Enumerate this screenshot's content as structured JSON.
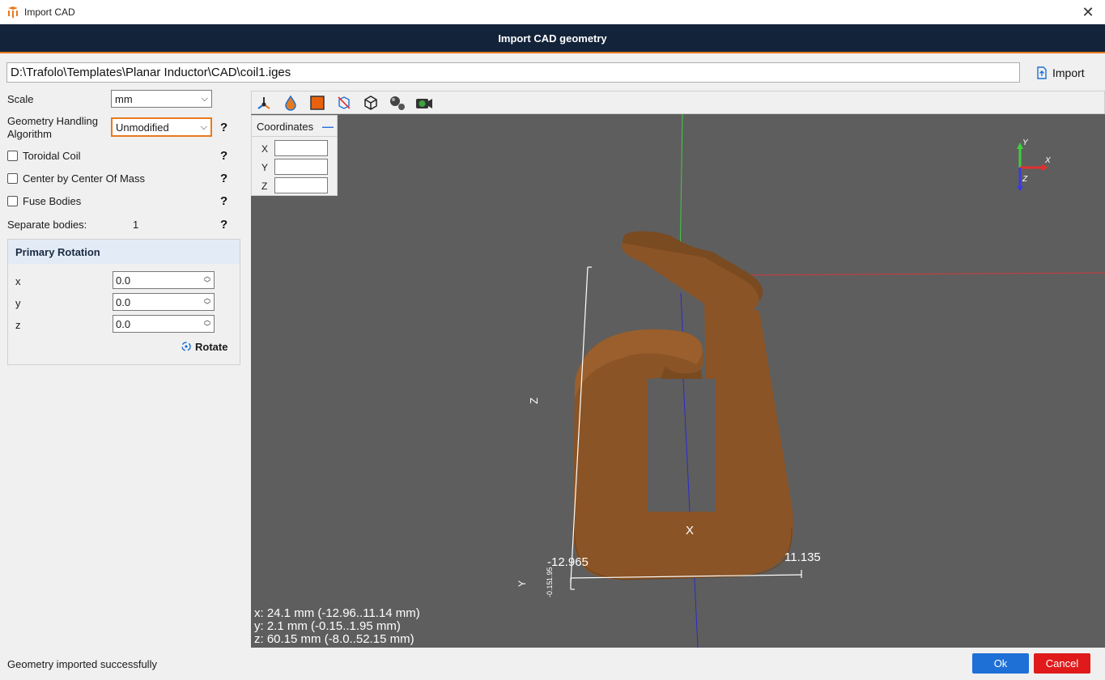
{
  "window": {
    "title": "Import CAD"
  },
  "header": {
    "title": "Import CAD geometry"
  },
  "path": {
    "value": "D:\\Trafolo\\Templates\\Planar Inductor\\CAD\\coil1.iges"
  },
  "import_button": {
    "label": "Import"
  },
  "settings": {
    "scale_label": "Scale",
    "scale_value": "mm",
    "algorithm_label_line1": "Geometry Handling",
    "algorithm_label_line2": "Algorithm",
    "algorithm_value": "Unmodified",
    "toroidal_label": "Toroidal Coil",
    "center_label": "Center by Center Of Mass",
    "fuse_label": "Fuse Bodies",
    "separate_label": "Separate bodies:",
    "separate_value": "1",
    "help": "?"
  },
  "rotation": {
    "title": "Primary Rotation",
    "x_label": "x",
    "x_value": "0.0",
    "y_label": "y",
    "y_value": "0.0",
    "z_label": "z",
    "z_value": "0.0",
    "rotate_label": "Rotate"
  },
  "coordinates": {
    "title": "Coordinates",
    "x_label": "X",
    "y_label": "Y",
    "z_label": "Z"
  },
  "viewer": {
    "axis_x_label": "X",
    "axis_z_label": "Z",
    "axis_y_label": "Y",
    "x_min_label": "-12.965",
    "x_max_label": "11.135",
    "y_range_label": "-0.15",
    "y_range_label2": "1.95",
    "triad_x": "X",
    "triad_y": "Y",
    "triad_z": "Z",
    "info_x": "x: 24.1 mm (-12.96..11.14 mm)",
    "info_y": "y: 2.1 mm (-0.15..1.95 mm)",
    "info_z": "z: 60.15 mm (-8.0..52.15 mm)"
  },
  "status": {
    "message": "Geometry imported successfully"
  },
  "buttons": {
    "ok": "Ok",
    "cancel": "Cancel"
  },
  "colors": {
    "header_bg": "#13233a",
    "accent": "#e87a1e",
    "coil": "#8a5426",
    "viewer_bg": "#5e5e5e",
    "ok": "#1e6fd6",
    "cancel": "#e01a1a"
  }
}
